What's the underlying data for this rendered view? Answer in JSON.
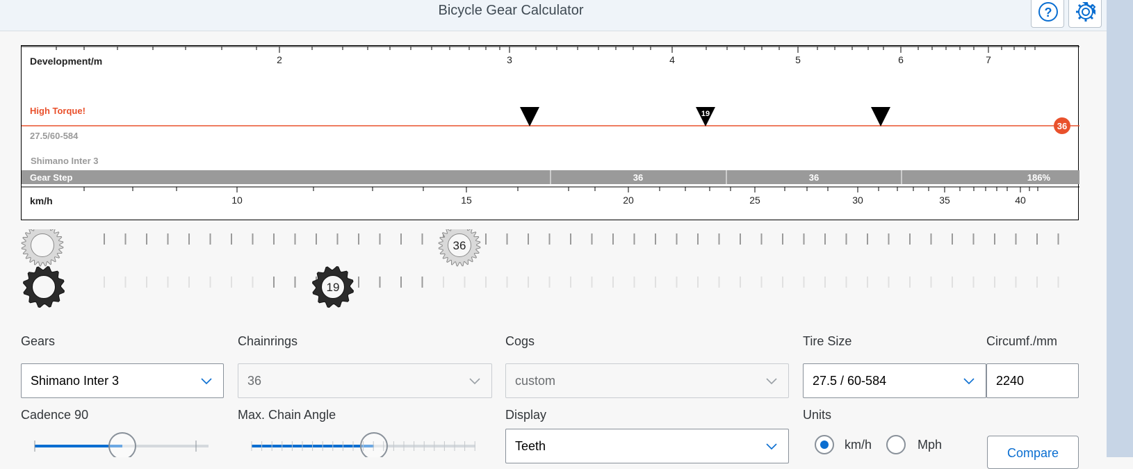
{
  "header": {
    "title": "Bicycle Gear Calculator",
    "help_icon": "question-circle-icon",
    "settings_icon": "gear-icon"
  },
  "chart": {
    "top_axis": {
      "label": "Development/m",
      "ticks": [
        "2",
        "3",
        "4",
        "5",
        "6",
        "7"
      ]
    },
    "warning": "High Torque!",
    "warning_color": "#e9512c",
    "tire_label": "27.5/60-584",
    "hub_label": "Shimano Inter 3",
    "gear_markers": [
      {
        "label": ""
      },
      {
        "label": "19"
      },
      {
        "label": ""
      }
    ],
    "chainring_badge": "36",
    "gear_step": {
      "label": "Gear Step",
      "segments": [
        "36",
        "36",
        "186%"
      ]
    },
    "bottom_axis": {
      "label": "km/h",
      "ticks": [
        "10",
        "15",
        "20",
        "25",
        "30",
        "35",
        "40"
      ]
    }
  },
  "sprockets": {
    "chainring_label": "36",
    "cog_label": "19"
  },
  "form": {
    "gears": {
      "label": "Gears",
      "value": "Shimano Inter 3"
    },
    "chainrings": {
      "label": "Chainrings",
      "value": "36"
    },
    "cogs": {
      "label": "Cogs",
      "value": "custom"
    },
    "tire_size": {
      "label": "Tire Size",
      "value": "27.5 / 60-584"
    },
    "circumference": {
      "label": "Circumf./mm",
      "value": "2240"
    },
    "cadence": {
      "label": "Cadence 90",
      "value": 90
    },
    "chain_angle": {
      "label": "Max. Chain Angle"
    },
    "display": {
      "label": "Display",
      "value": "Teeth"
    },
    "units": {
      "label": "Units",
      "options": [
        "km/h",
        "Mph"
      ],
      "selected": "km/h"
    },
    "compare_label": "Compare"
  },
  "colors": {
    "accent": "#0a6ed1",
    "warning": "#e9512c",
    "gear_step_bar": "#9a9a9a"
  }
}
